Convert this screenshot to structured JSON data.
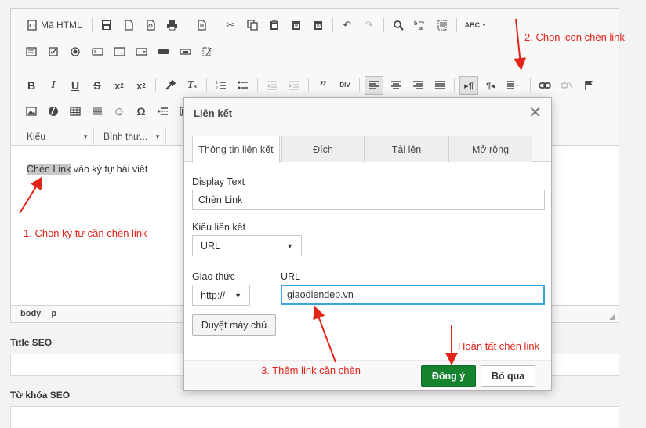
{
  "editor": {
    "toolbar": {
      "source_label": "Mã HTML",
      "styles_combo": "Kiểu",
      "format_combo": "Bình thư..."
    },
    "content": {
      "selected_text": "Chèn Link",
      "rest_text": " vào ký tự bài viết"
    },
    "statusbar": [
      "body",
      "p"
    ]
  },
  "fields": {
    "title_seo_label": "Title SEO",
    "keywords_seo_label": "Từ khóa SEO"
  },
  "annotations": {
    "step1": "1. Chọn ký tự cần chèn link",
    "step2": "2. Chọn icon chèn link",
    "step3": "3. Thêm link cần chèn",
    "step4": "Hoàn tất chèn link",
    "color": "#e2231a"
  },
  "dialog": {
    "title": "Liên kết",
    "tabs": [
      "Thông tin liên kết",
      "Đích",
      "Tải lên",
      "Mở rộng"
    ],
    "active_tab": "Thông tin liên kết",
    "display_text_label": "Display Text",
    "display_text_value": "Chèn Link",
    "link_type_label": "Kiểu liên kết",
    "link_type_value": "URL",
    "protocol_label": "Giao thức",
    "protocol_value": "http://",
    "url_label": "URL",
    "url_value": "giaodiendep.vn",
    "browse_server_label": "Duyệt máy chủ",
    "ok_label": "Đồng ý",
    "cancel_label": "Bỏ qua",
    "ok_color": "#15822f"
  }
}
